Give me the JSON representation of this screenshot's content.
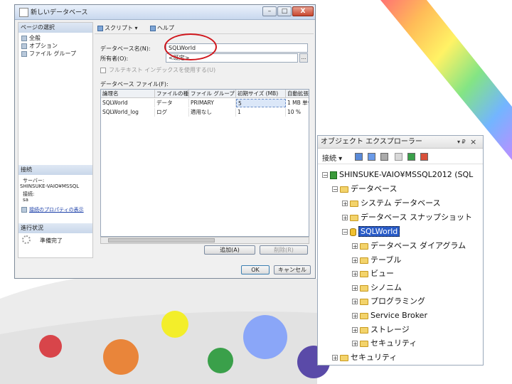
{
  "dialog": {
    "title": "新しいデータベース",
    "window_buttons": {
      "minimize": "–",
      "maximize": "□",
      "close": "X"
    },
    "select_page_header": "ページの選択",
    "nav_items": [
      "全般",
      "オプション",
      "ファイル グループ"
    ],
    "connection_header": "接続",
    "server_label": "サーバー:",
    "server_value": "SHINSUKE-VAIO¥MSSQL",
    "connection_label": "接続:",
    "connection_value": "sa",
    "view_connection_link": "接続のプロパティの表示",
    "progress_header": "進行状況",
    "progress_status": "準備完了",
    "toolbar": {
      "script": "スクリプト",
      "help": "ヘルプ"
    },
    "db_name_label": "データベース名(N):",
    "db_name_value": "SQLWorld",
    "owner_label": "所有者(O):",
    "owner_value": "<既定>",
    "owner_browse": "...",
    "fulltext_label": "フルテキスト インデックスを使用する(U)",
    "db_files_label": "データベース ファイル(F):",
    "grid_columns": [
      "論理名",
      "ファイルの種類",
      "ファイル グループ",
      "初期サイズ (MB)",
      "自動拡張"
    ],
    "grid_rows": [
      [
        "SQLWorld",
        "データ",
        "PRIMARY",
        "5",
        "1 MB 単位"
      ],
      [
        "SQLWorld_log",
        "ログ",
        "適用なし",
        "1",
        "10 %"
      ]
    ],
    "add_button": "追加(A)",
    "remove_button": "削除(R)",
    "ok_button": "OK",
    "cancel_button": "キャンセル"
  },
  "object_explorer": {
    "title": "オブジェクト エクスプローラー",
    "pin": "▾ ₽",
    "close": "×",
    "connect_button": "接続 ▾",
    "tree": {
      "server": "SHINSUKE-VAIO¥MSSQL2012 (SQL",
      "databases": "データベース",
      "system_databases": "システム データベース",
      "snapshots": "データベース スナップショット",
      "selected_db": "SQLWorld",
      "db_children": [
        "データベース ダイアグラム",
        "テーブル",
        "ビュー",
        "シノニム",
        "プログラミング",
        "Service Broker",
        "ストレージ",
        "セキュリティ"
      ],
      "security": "セキュリティ"
    }
  },
  "colors": {
    "highlight": "#d0161c",
    "selection": "#2a5cc8"
  }
}
